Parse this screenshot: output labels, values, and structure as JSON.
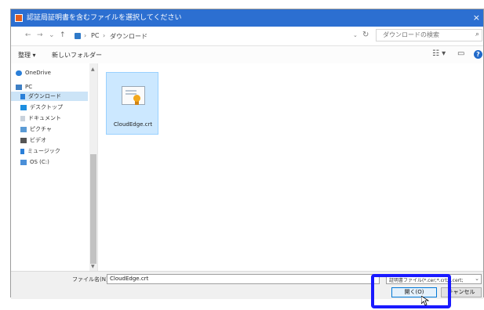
{
  "window": {
    "title": "認証局証明書を含むファイルを選択してください",
    "close_glyph": "×"
  },
  "address_bar": {
    "back_glyph": "←",
    "forward_glyph": "→",
    "recent_glyph": "⌄",
    "up_glyph": "↑",
    "breadcrumbs": [
      "PC",
      "ダウンロード"
    ],
    "separator": "›",
    "dropdown_glyph": "⌄",
    "refresh_glyph": "↻",
    "search_placeholder": "ダウンロードの検索",
    "search_icon": "⌕"
  },
  "toolbar": {
    "organize_label": "整理 ▾",
    "new_folder_label": "新しいフォルダー",
    "view_glyph": "☷ ▾",
    "pane_glyph": "▭",
    "help_glyph": "?"
  },
  "nav": {
    "items": [
      {
        "label": "OneDrive",
        "icon": "cloud-icon",
        "color": "#2a7fd8"
      },
      {
        "label": "PC",
        "icon": "pc-icon",
        "color": "#3e7fc4"
      },
      {
        "label": "ダウンロード",
        "icon": "download-icon",
        "color": "#2a7fd8",
        "selected": true
      },
      {
        "label": "デスクトップ",
        "icon": "desktop-icon",
        "color": "#1d8ee0"
      },
      {
        "label": "ドキュメント",
        "icon": "documents-icon",
        "color": "#9aa7b5"
      },
      {
        "label": "ピクチャ",
        "icon": "pictures-icon",
        "color": "#5b9bd5"
      },
      {
        "label": "ビデオ",
        "icon": "videos-icon",
        "color": "#555555"
      },
      {
        "label": "ミュージック",
        "icon": "music-icon",
        "color": "#2a7fd8"
      },
      {
        "label": "OS (C:)",
        "icon": "drive-icon",
        "color": "#4a8fd8"
      }
    ],
    "scroll_up_glyph": "▲",
    "scroll_down_glyph": "▼"
  },
  "files": [
    {
      "name": "CloudEdge.crt",
      "icon": "certificate-icon",
      "selected": true
    }
  ],
  "bottom": {
    "filename_label": "ファイル名(N):",
    "filename_value": "CloudEdge.crt",
    "filetype_label": "証明書ファイル(*.cer;*.crt;*.cert;",
    "filetype_arrow": "⌄",
    "open_label": "開く(O)",
    "cancel_label": "キャンセル"
  },
  "colors": {
    "titlebar": "#2c6fd1",
    "highlight": "#1a1aff",
    "selection": "#cce8ff"
  }
}
